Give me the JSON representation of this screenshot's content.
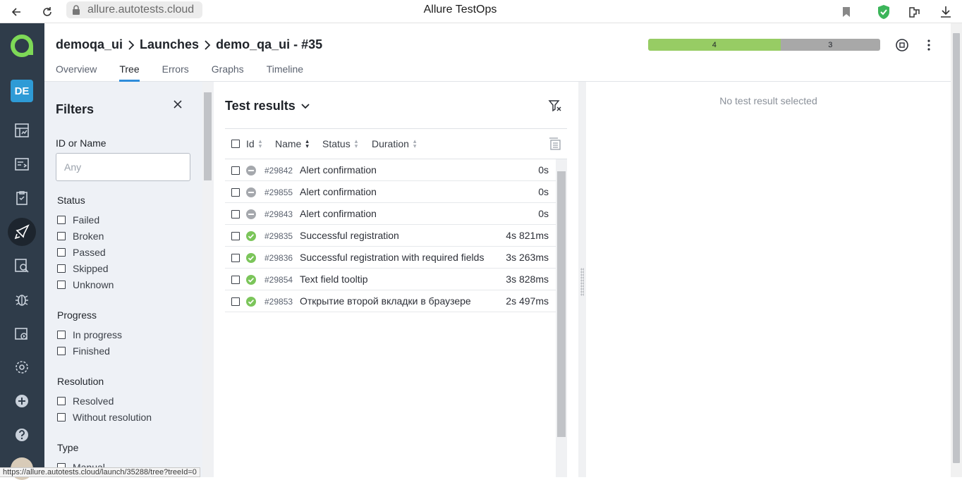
{
  "browser": {
    "url": "allure.autotests.cloud",
    "title": "Allure TestOps",
    "status_url": "https://allure.autotests.cloud/launch/35288/tree?treeId=0"
  },
  "nav": {
    "project_badge": "DE",
    "icons": [
      "dashboard-icon",
      "test-cases-icon",
      "test-plans-icon",
      "launches-icon",
      "analytics-icon",
      "defects-icon",
      "jobs-icon",
      "settings-icon",
      "add-icon",
      "help-icon"
    ]
  },
  "header": {
    "breadcrumb": [
      "demoqa_ui",
      "Launches",
      "demo_qa_ui - #35"
    ],
    "tabs": [
      "Overview",
      "Tree",
      "Errors",
      "Graphs",
      "Timeline"
    ],
    "active_tab": "Tree",
    "stats": {
      "passed": "4",
      "skipped": "3",
      "passed_share": 0.57
    },
    "colors": {
      "passed": "#97cc64",
      "skipped": "#a8a8a8",
      "accent": "#2e8ddb"
    }
  },
  "filters": {
    "title": "Filters",
    "id_label": "ID or Name",
    "id_placeholder": "Any",
    "status_label": "Status",
    "status_options": [
      "Failed",
      "Broken",
      "Passed",
      "Skipped",
      "Unknown"
    ],
    "progress_label": "Progress",
    "progress_options": [
      "In progress",
      "Finished"
    ],
    "resolution_label": "Resolution",
    "resolution_options": [
      "Resolved",
      "Without resolution"
    ],
    "type_label": "Type",
    "type_options": [
      "Manual"
    ]
  },
  "results": {
    "title": "Test results",
    "columns": {
      "id": "Id",
      "name": "Name",
      "status": "Status",
      "duration": "Duration"
    },
    "rows": [
      {
        "id": "#29842",
        "name": "Alert confirmation",
        "duration": "0s",
        "status": "skipped"
      },
      {
        "id": "#29855",
        "name": "Alert confirmation",
        "duration": "0s",
        "status": "skipped"
      },
      {
        "id": "#29843",
        "name": "Alert confirmation",
        "duration": "0s",
        "status": "skipped"
      },
      {
        "id": "#29835",
        "name": "Successful registration",
        "duration": "4s 821ms",
        "status": "passed"
      },
      {
        "id": "#29836",
        "name": "Successful registration with required fields",
        "duration": "3s 263ms",
        "status": "passed"
      },
      {
        "id": "#29854",
        "name": "Text field tooltip",
        "duration": "3s 828ms",
        "status": "passed"
      },
      {
        "id": "#29853",
        "name": "Открытие второй вкладки в браузере",
        "duration": "2s 497ms",
        "status": "passed"
      }
    ]
  },
  "detail": {
    "empty_text": "No test result selected"
  }
}
